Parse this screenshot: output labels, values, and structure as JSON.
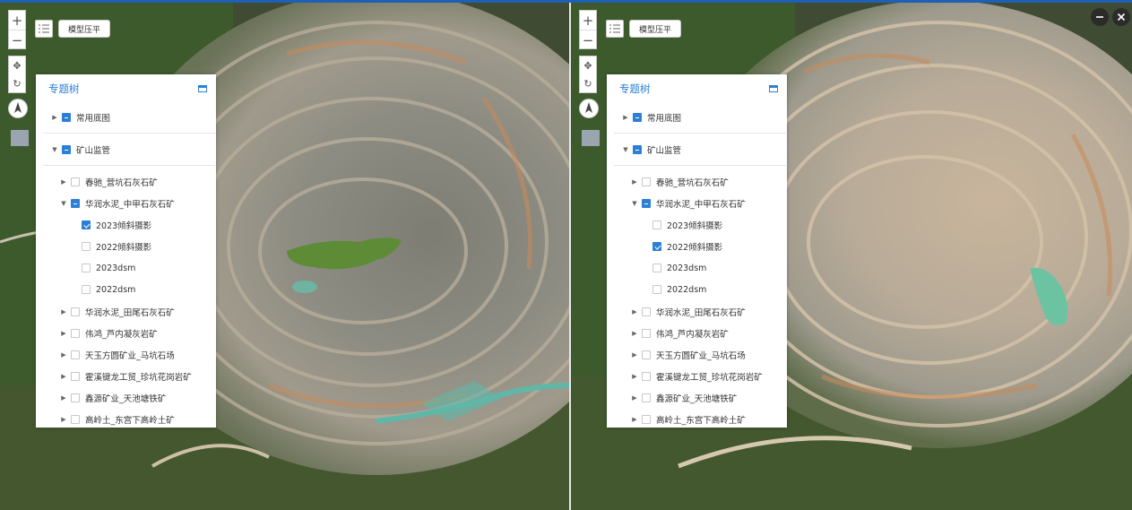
{
  "toolbar": {
    "zoom_in_icon": "plus-icon",
    "zoom_out_icon": "minus-icon",
    "flatten_label": "模型压平"
  },
  "layer_tree": {
    "title": "专题树",
    "groups": [
      {
        "label": "常用底图",
        "state": "partial",
        "expanded": false
      },
      {
        "label": "矿山监管",
        "state": "partial",
        "expanded": true
      }
    ],
    "mines": [
      "春驰_营坑石灰石矿",
      "华润水泥_中甲石灰石矿",
      "华润水泥_田尾石灰石矿",
      "伟鸿_芦内凝灰岩矿",
      "天玉方圆矿业_马坑石场",
      "霍溪键龙工贸_珍坑花岗岩矿",
      "鑫源矿业_天池塘铁矿",
      "高岭土_东宫下高岭土矿"
    ],
    "sublayers": [
      "2023倾斜摄影",
      "2022倾斜摄影",
      "2023dsm",
      "2022dsm"
    ]
  },
  "left_view": {
    "checked_sublayer": "2023倾斜摄影"
  },
  "right_view": {
    "checked_sublayer": "2022倾斜摄影"
  },
  "window_controls": {
    "minimize_icon": "minimize-icon",
    "close_icon": "close-icon"
  },
  "colors": {
    "accent": "#2d7fd6",
    "topbar": "#1f5fb4"
  }
}
